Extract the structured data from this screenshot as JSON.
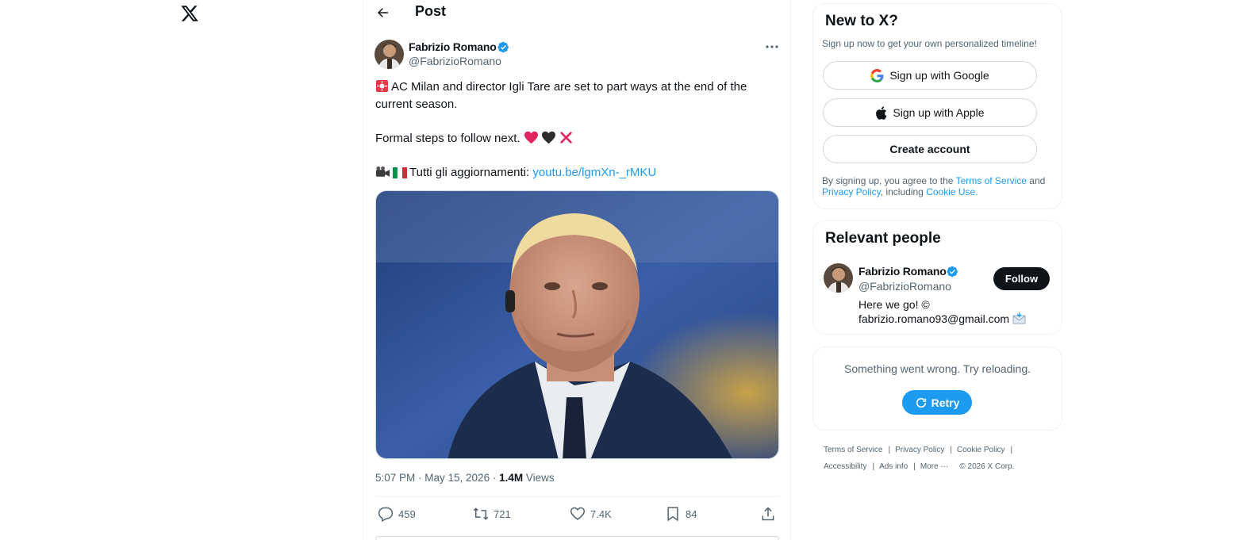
{
  "header": {
    "title": "Post"
  },
  "post": {
    "author_name": "Fabrizio Romano",
    "author_handle": "@FabrizioRomano",
    "line1": "AC Milan and director Igli Tare are set to part ways at the end of the",
    "line2": "current season.",
    "line3": "Formal steps to follow next.",
    "line4": "Tutti gli aggiornamenti:",
    "link": "youtu.be/lgmXn-_rMKU",
    "time": "5:07 PM · May 15, 2026 ·",
    "views_count": "1.4M",
    "views_label": "Views",
    "actions": {
      "replies": "459",
      "reposts": "721",
      "likes": "7.4K",
      "bookmarks": "84"
    }
  },
  "signup": {
    "title": "New to X?",
    "subtitle": "Sign up now to get your own personalized timeline!",
    "google": "Sign up with Google",
    "apple": "Sign up with Apple",
    "create": "Create account",
    "legal_prefix": "By signing up, you agree to the",
    "terms": "Terms of Service",
    "and": "and",
    "privacy": "Privacy Policy",
    "including": ", including",
    "cookie": "Cookie Use."
  },
  "relevant": {
    "title": "Relevant people",
    "name": "Fabrizio Romano",
    "handle": "@FabrizioRomano",
    "bio_line1": "Here we go! ©",
    "bio_line2": "fabrizio.romano93@gmail.com",
    "follow": "Follow"
  },
  "error": {
    "message": "Something went wrong. Try reloading.",
    "retry": "Retry"
  },
  "footer": {
    "terms": "Terms of Service",
    "privacy": "Privacy Policy",
    "cookie": "Cookie Policy",
    "accessibility": "Accessibility",
    "ads": "Ads info",
    "more": "More ···",
    "copyright": "© 2026 X Corp."
  },
  "colors": {
    "accent": "#1d9bf0",
    "text": "#0f1419",
    "muted": "#536471",
    "border": "#eff3f4"
  },
  "icons": [
    "x-logo",
    "back-arrow",
    "verified-badge",
    "more-dots",
    "siren-emoji",
    "red-heart",
    "black-heart",
    "cross-mark",
    "camera-emoji",
    "italy-flag",
    "reply",
    "repost",
    "like",
    "bookmark",
    "share",
    "google-logo",
    "apple-logo",
    "refresh",
    "envelope"
  ]
}
